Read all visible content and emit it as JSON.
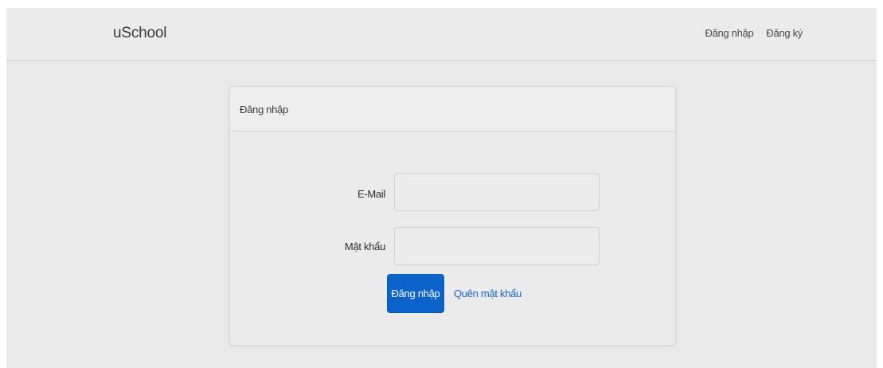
{
  "navbar": {
    "brand": "uSchool",
    "links": [
      {
        "label": "Đăng nhập"
      },
      {
        "label": "Đăng ký"
      }
    ]
  },
  "login_card": {
    "title": "Đăng nhập",
    "email": {
      "label": "E-Mail",
      "value": ""
    },
    "password": {
      "label": "Mật khẩu",
      "value": ""
    },
    "submit_label": "Đăng nhập",
    "forgot_label": "Quên mật khẩu"
  },
  "colors": {
    "page_background": "#e9e9e9",
    "primary_button": "#0b63c9",
    "link": "#1a62c4"
  }
}
